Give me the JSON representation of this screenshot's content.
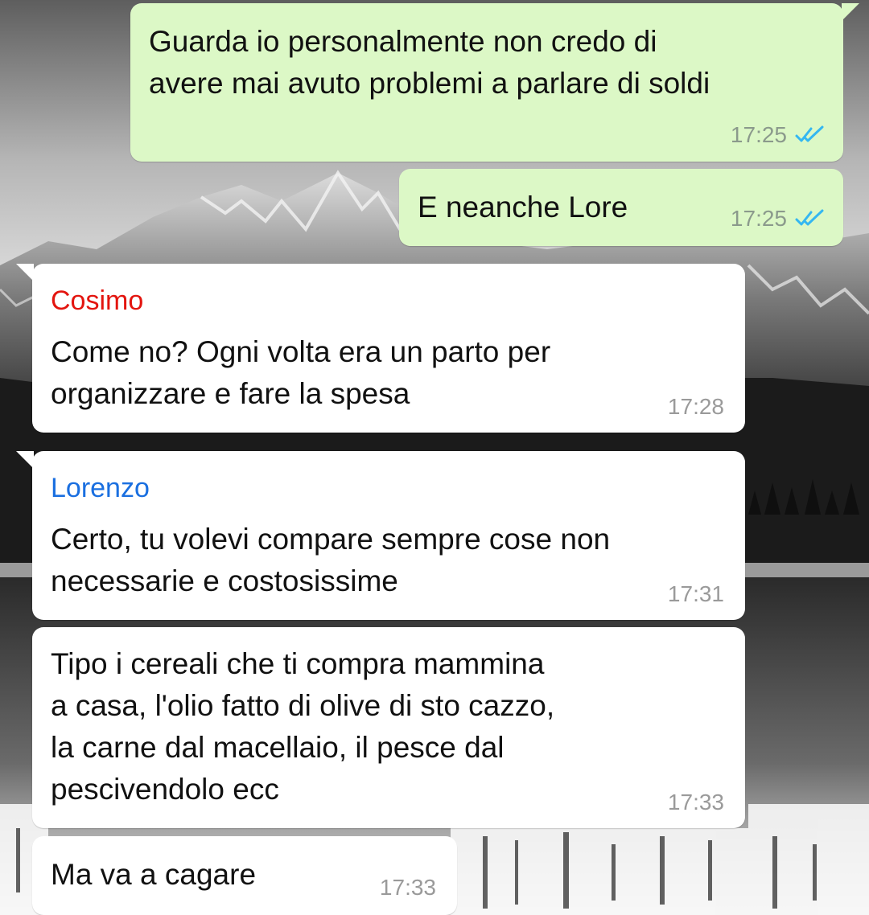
{
  "conversation": {
    "messages": [
      {
        "direction": "outgoing",
        "lines": [
          "Guarda io personalmente non credo di",
          "avere mai avuto problemi a parlare di soldi"
        ],
        "time": "17:25",
        "status_icon": "double-check-read-icon"
      },
      {
        "direction": "outgoing",
        "lines": [
          "E neanche Lore"
        ],
        "time": "17:25",
        "status_icon": "double-check-read-icon"
      },
      {
        "direction": "incoming",
        "sender": "Cosimo",
        "sender_color": "#e3150f",
        "lines": [
          "Come no? Ogni volta era un parto per",
          "organizzare e fare la spesa"
        ],
        "time": "17:28"
      },
      {
        "direction": "incoming",
        "sender": "Lorenzo",
        "sender_color": "#1a6fe0",
        "lines": [
          "Certo, tu volevi compare sempre cose non",
          "necessarie e costosissime"
        ],
        "time": "17:31"
      },
      {
        "direction": "incoming",
        "lines": [
          "Tipo i cereali che ti compra mammina",
          "a casa, l'olio fatto di olive di sto cazzo,",
          "la carne dal macellaio, il pesce dal",
          "pescivendolo ecc"
        ],
        "time": "17:33"
      },
      {
        "direction": "incoming",
        "lines": [
          "Ma va a cagare"
        ],
        "time": "17:33"
      }
    ]
  },
  "colors": {
    "outgoing_bubble": "#dcf8c6",
    "incoming_bubble": "#ffffff",
    "read_ticks": "#34b7f1",
    "timestamp": "#8b9a8c"
  },
  "wallpaper": {
    "description_icon": "mountain-lake-wallpaper"
  }
}
